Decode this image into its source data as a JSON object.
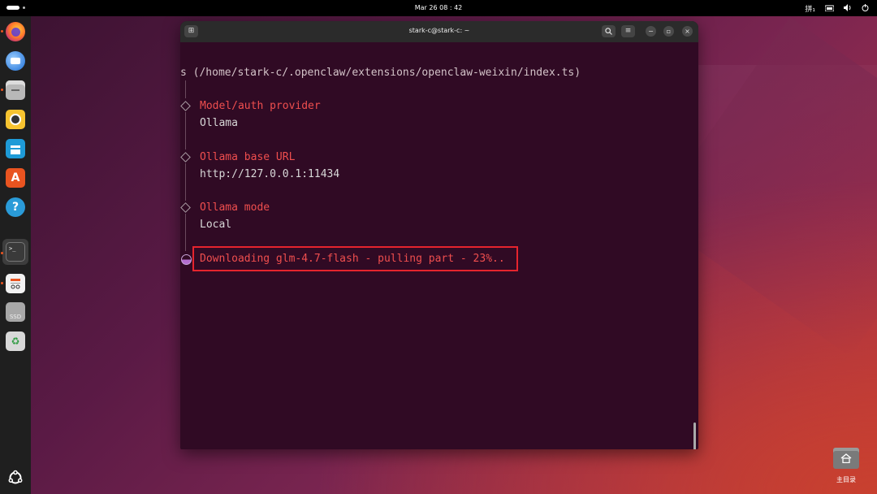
{
  "topbar": {
    "clock": "Mar 26  08 : 42",
    "input_method": "拼₁"
  },
  "dock": {
    "items": [
      {
        "name": "firefox"
      },
      {
        "name": "thunderbird"
      },
      {
        "name": "files"
      },
      {
        "name": "rhythmbox"
      },
      {
        "name": "libreoffice-writer"
      },
      {
        "name": "app-center"
      },
      {
        "name": "help"
      },
      {
        "name": "terminal",
        "label": ">_"
      },
      {
        "name": "document-viewer"
      },
      {
        "name": "ssd",
        "label": "SSD"
      },
      {
        "name": "trash"
      }
    ]
  },
  "window": {
    "title": "stark-c@stark-c: ~"
  },
  "terminal": {
    "path_line": "s (/home/stark-c/.openclaw/extensions/openclaw-weixin/index.ts)",
    "entries": [
      {
        "label": "Model/auth provider",
        "value": "Ollama"
      },
      {
        "label": "Ollama base URL",
        "value": "http://127.0.0.1:11434"
      },
      {
        "label": "Ollama mode",
        "value": "Local"
      }
    ],
    "status_line": "Downloading glm-4.7-flash - pulling part - 23%.."
  },
  "desktop": {
    "home_label": "主目录"
  },
  "colors": {
    "terminal_bg": "#300a24",
    "accent": "#e95420",
    "label_red": "#ef4e4e",
    "highlight_border": "#e5242d"
  }
}
